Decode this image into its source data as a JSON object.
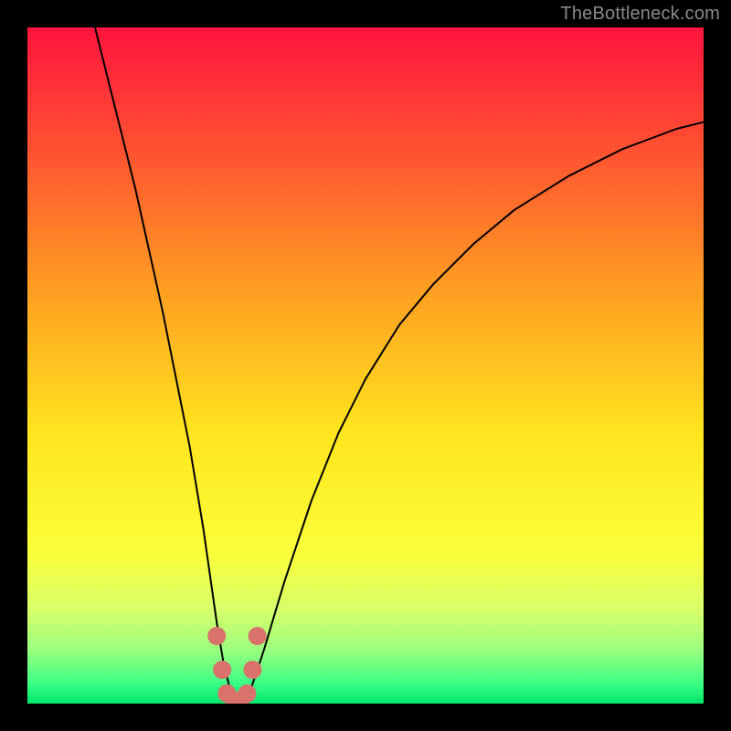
{
  "attribution": "TheBottleneck.com",
  "chart_data": {
    "type": "line",
    "title": "",
    "xlabel": "",
    "ylabel": "",
    "xlim": [
      0,
      100
    ],
    "ylim": [
      0,
      100
    ],
    "curve": {
      "name": "bottleneck-curve",
      "x": [
        10,
        12,
        14,
        16,
        18,
        20,
        22,
        24,
        26,
        27,
        28,
        29,
        30,
        31,
        32,
        33,
        35,
        38,
        42,
        46,
        50,
        55,
        60,
        66,
        72,
        80,
        88,
        96,
        100
      ],
      "y": [
        100,
        92,
        84,
        76,
        67,
        58,
        48,
        38,
        26,
        19,
        12,
        6,
        2,
        0,
        0,
        2,
        8,
        18,
        30,
        40,
        48,
        56,
        62,
        68,
        73,
        78,
        82,
        85,
        86
      ]
    },
    "markers": {
      "name": "highlight-dots",
      "color": "#d9726b",
      "points": [
        {
          "x": 28.0,
          "y": 10
        },
        {
          "x": 28.8,
          "y": 5
        },
        {
          "x": 29.5,
          "y": 1.5
        },
        {
          "x": 30.5,
          "y": 0.5
        },
        {
          "x": 31.5,
          "y": 0.5
        },
        {
          "x": 32.5,
          "y": 1.5
        },
        {
          "x": 33.3,
          "y": 5
        },
        {
          "x": 34.0,
          "y": 10
        }
      ]
    },
    "gradient_stops": [
      {
        "offset": 0,
        "color": "#ff143d"
      },
      {
        "offset": 18,
        "color": "#ff5131"
      },
      {
        "offset": 40,
        "color": "#ffa321"
      },
      {
        "offset": 60,
        "color": "#ffe51e"
      },
      {
        "offset": 78,
        "color": "#faff3a"
      },
      {
        "offset": 86,
        "color": "#d8ff6a"
      },
      {
        "offset": 92,
        "color": "#9cff7d"
      },
      {
        "offset": 97,
        "color": "#3bff85"
      },
      {
        "offset": 100,
        "color": "#00e66b"
      }
    ]
  }
}
